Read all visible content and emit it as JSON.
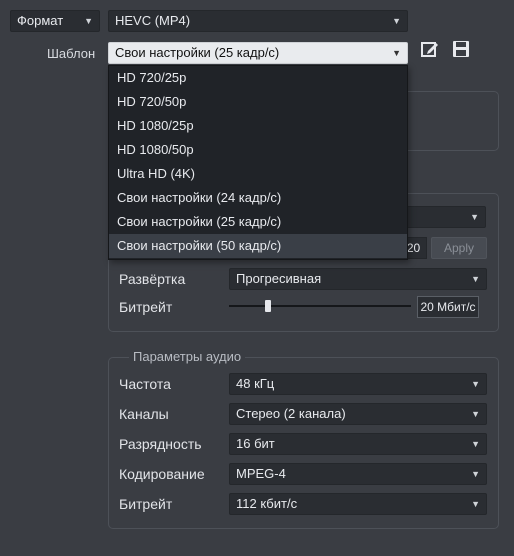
{
  "top": {
    "format_label": "Формат",
    "format_value": "HEVC (MP4)",
    "template_label": "Шаблон",
    "template_value": "Свои настройки (25 кадр/с)"
  },
  "template_menu": {
    "items": [
      "HD 720/25p",
      "HD 720/50p",
      "HD 1080/25p",
      "HD 1080/50p",
      "Ultra HD (4K)",
      "Свои настройки (24 кадр/с)",
      "Свои настройки (25 кадр/с)",
      "Свои настройки (50 кадр/с)"
    ],
    "highlighted_index": 7
  },
  "video": {
    "size_field_value": "20",
    "apply_label": "Apply",
    "scan_label": "Развёртка",
    "scan_value": "Прогресивная",
    "bitrate_label": "Битрейт",
    "bitrate_value": "20 Мбит/с",
    "bitrate_slider_fraction": 0.2
  },
  "audio": {
    "group_title": "Параметры аудио",
    "rows": [
      {
        "label": "Частота",
        "value": "48 кГц"
      },
      {
        "label": "Каналы",
        "value": "Стерео (2 канала)"
      },
      {
        "label": "Разрядность",
        "value": "16 бит"
      },
      {
        "label": "Кодирование",
        "value": "MPEG-4"
      },
      {
        "label": "Битрейт",
        "value": "112 кбит/с"
      }
    ]
  }
}
